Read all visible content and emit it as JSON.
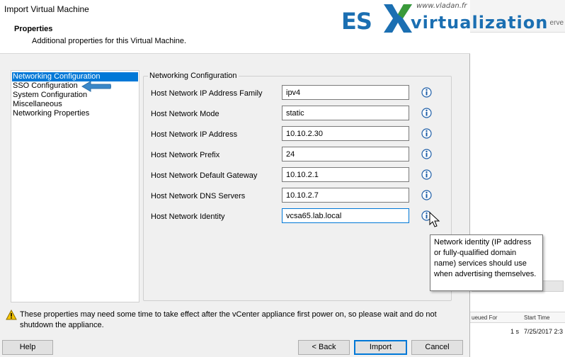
{
  "window": {
    "title": "Import Virtual Machine"
  },
  "header": {
    "title": "Properties",
    "subtitle": "Additional properties for this Virtual Machine."
  },
  "nav": {
    "items": [
      {
        "label": "Networking Configuration",
        "selected": true
      },
      {
        "label": "SSO Configuration",
        "selected": false
      },
      {
        "label": "System Configuration",
        "selected": false
      },
      {
        "label": "Miscellaneous",
        "selected": false
      },
      {
        "label": "Networking Properties",
        "selected": false
      }
    ]
  },
  "group": {
    "title": "Networking Configuration"
  },
  "fields": [
    {
      "label": "Host Network IP Address Family",
      "value": "ipv4"
    },
    {
      "label": "Host Network Mode",
      "value": "static"
    },
    {
      "label": "Host Network IP Address",
      "value": "10.10.2.30"
    },
    {
      "label": "Host Network Prefix",
      "value": "24"
    },
    {
      "label": "Host Network Default Gateway",
      "value": "10.10.2.1"
    },
    {
      "label": "Host Network DNS Servers",
      "value": "10.10.2.7"
    },
    {
      "label": "Host Network Identity",
      "value": "vcsa65.lab.local"
    }
  ],
  "tooltip": {
    "text": "Network identity (IP address or fully-qualified domain name) services should use when advertising themselves."
  },
  "footer": {
    "warning": "These properties may need some time to take effect after the vCenter appliance first power on, so please wait and do not shutdown the appliance."
  },
  "buttons": {
    "help": "Help",
    "back": "< Back",
    "import": "Import",
    "cancel": "Cancel"
  },
  "watermark": {
    "prefix": "ES",
    "suffix": "virtualization",
    "site": "www.vladan.fr"
  },
  "background_app": {
    "top_text": "erve",
    "columns": [
      "ueued For",
      "Start Time"
    ],
    "row": [
      "1 s",
      "7/25/2017 2:3"
    ]
  },
  "colors": {
    "selection": "#0078d7",
    "arrow": "#3a87c8",
    "info_icon": "#1f5fa8",
    "warning": "#f5c400",
    "brand": "#1b6fb2"
  },
  "icons": {
    "info": "info-icon",
    "warning": "warning-icon",
    "cursor": "mouse-pointer-icon",
    "arrow": "left-arrow-icon"
  }
}
